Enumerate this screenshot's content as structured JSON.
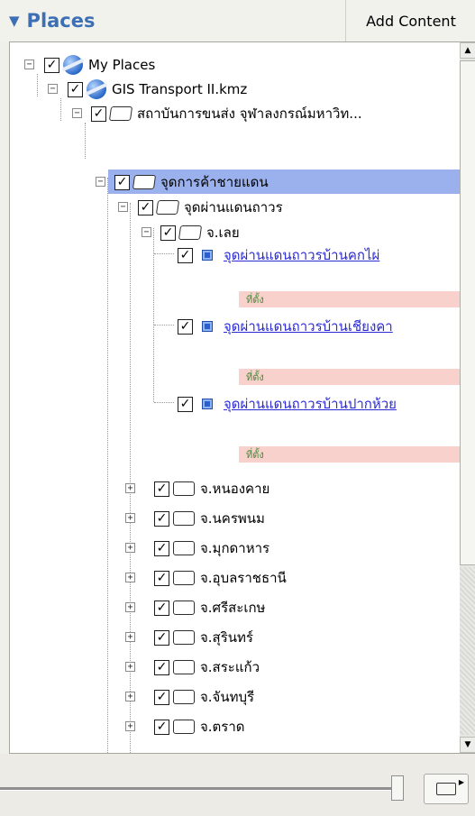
{
  "header": {
    "title": "Places",
    "add_content": "Add Content"
  },
  "tree": {
    "my_places": "My Places",
    "kmz": "GIS Transport II.kmz",
    "institute": "สถาบันการขนส่ง จุฬาลงกรณ์มหาวิท...",
    "border_trade": "จุดการค้าชายแดน",
    "permanent": "จุดผ่านแดนถาวร",
    "loei": "จ.เลย",
    "places": [
      {
        "name": "จุดผ่านแดนถาวรบ้านคกไผ่",
        "sub": "ที่ตั้ง"
      },
      {
        "name": "จุดผ่านแดนถาวรบ้านเชียงคา",
        "sub": "ที่ตั้ง"
      },
      {
        "name": "จุดผ่านแดนถาวรบ้านปากห้วย",
        "sub": "ที่ตั้ง"
      }
    ],
    "provinces": [
      "จ.หนองคาย",
      "จ.นครพนม",
      "จ.มุกดาหาร",
      "จ.อุบลราชธานี",
      "จ.ศรีสะเกษ",
      "จ.สุรินทร์",
      "จ.สระแก้ว",
      "จ.จันทบุรี",
      "จ.ตราด"
    ]
  },
  "colors": {
    "title": "#3d6fb4",
    "selection": "#9ab1ee",
    "link": "#2a2ad6",
    "note_bg": "#f8d0cc"
  },
  "icons": {
    "expand": "minus-box",
    "collapse": "plus-box",
    "check": "checkmark",
    "folder": "folder-icon",
    "globe": "globe-icon",
    "placemark": "placemark-icon"
  }
}
